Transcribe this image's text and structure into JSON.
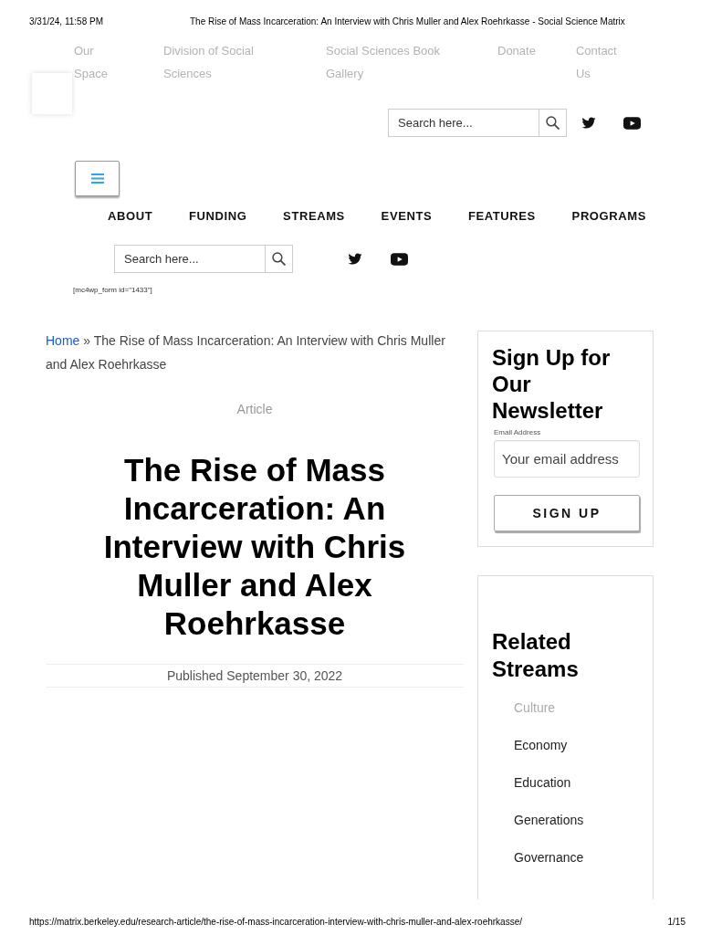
{
  "print_header": {
    "date": "3/31/24, 11:58 PM",
    "title": "The Rise of Mass Incarceration: An Interview with Chris Muller and Alex Roehrkasse - Social Science Matrix"
  },
  "top_links": [
    "Our Space",
    "Division of Social Sciences",
    "Social Sciences Book Gallery",
    "Donate",
    "Contact Us"
  ],
  "header_search": {
    "placeholder": "Search here..."
  },
  "nav": [
    "ABOUT",
    "FUNDING",
    "STREAMS",
    "EVENTS",
    "FEATURES",
    "PROGRAMS"
  ],
  "nav_search": {
    "placeholder": "Search here..."
  },
  "shortcode_text": "[mc4wp_form id=\"1433\"]",
  "breadcrumb": {
    "link": "Home",
    "separator": "»",
    "current": "The Rise of Mass Incarceration: An Interview with Chris Muller and Alex Roehrkasse"
  },
  "article": {
    "category": "Article",
    "title": "The Rise of Mass Incarceration: An Interview with Chris Muller and Alex Roehrkasse",
    "published": "Published September 30, 2022"
  },
  "newsletter": {
    "title": "Sign Up for Our Newsletter",
    "email": {
      "label": "Email Address",
      "placeholder": "Your email address"
    },
    "button": "SIGN UP"
  },
  "related_streams": {
    "title": "Related Streams",
    "items": [
      {
        "label": "Culture",
        "selected": true
      },
      {
        "label": "Economy",
        "selected": false
      },
      {
        "label": "Education",
        "selected": false
      },
      {
        "label": "Generations",
        "selected": false
      },
      {
        "label": "Governance",
        "selected": false
      }
    ]
  },
  "print_footer": {
    "url": "https://matrix.berkeley.edu/research-article/the-rise-of-mass-incarceration-interview-with-chris-muller-and-alex-roehrkasse/",
    "page": "1/15"
  }
}
